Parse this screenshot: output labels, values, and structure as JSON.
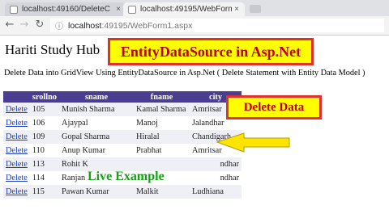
{
  "browser": {
    "tabs": [
      {
        "title": "localhost:49160/DeleteC",
        "active": false
      },
      {
        "title": "localhost:49195/WebForm",
        "active": true
      }
    ],
    "url_host": "localhost",
    "url_path": ":49195/WebForm1.aspx"
  },
  "page": {
    "site_title": "Hariti Study Hub",
    "description": "Delete Data into GridView Using EntityDataSource in Asp.Net ( Delete Statement with Entity Data Model )"
  },
  "callouts": {
    "title": "EntityDataSource in Asp.Net",
    "delete": "Delete Data",
    "live": "Live Example"
  },
  "colors": {
    "header_bg": "#4b3d8f",
    "callout_bg": "#ffff00",
    "callout_border": "#e03030",
    "callout_text": "#c00000",
    "live_text": "#18a018",
    "arrow_fill": "#ffe400"
  },
  "grid": {
    "columns": [
      "",
      "srollno",
      "sname",
      "fname",
      "city"
    ],
    "rows": [
      {
        "action": "Delete",
        "srollno": "105",
        "sname": "Munish Sharma",
        "fname": "Kamal Sharma",
        "city": "Amritsar"
      },
      {
        "action": "Delete",
        "srollno": "106",
        "sname": "Ajaypal",
        "fname": "Manoj",
        "city": "Jalandhar"
      },
      {
        "action": "Delete",
        "srollno": "109",
        "sname": "Gopal Sharma",
        "fname": "Hiralal",
        "city": "Chandigarh"
      },
      {
        "action": "Delete",
        "srollno": "110",
        "sname": "Anup Kumar",
        "fname": "Prabhat",
        "city": "Amritsar"
      },
      {
        "action": "Delete",
        "srollno": "113",
        "sname": "Rohit K",
        "fname": "",
        "city": "ndhar"
      },
      {
        "action": "Delete",
        "srollno": "114",
        "sname": "Ranjan",
        "fname": "",
        "city": "ndhar"
      },
      {
        "action": "Delete",
        "srollno": "115",
        "sname": "Pawan Kumar",
        "fname": "Malkit",
        "city": "Ludhiana"
      }
    ]
  }
}
